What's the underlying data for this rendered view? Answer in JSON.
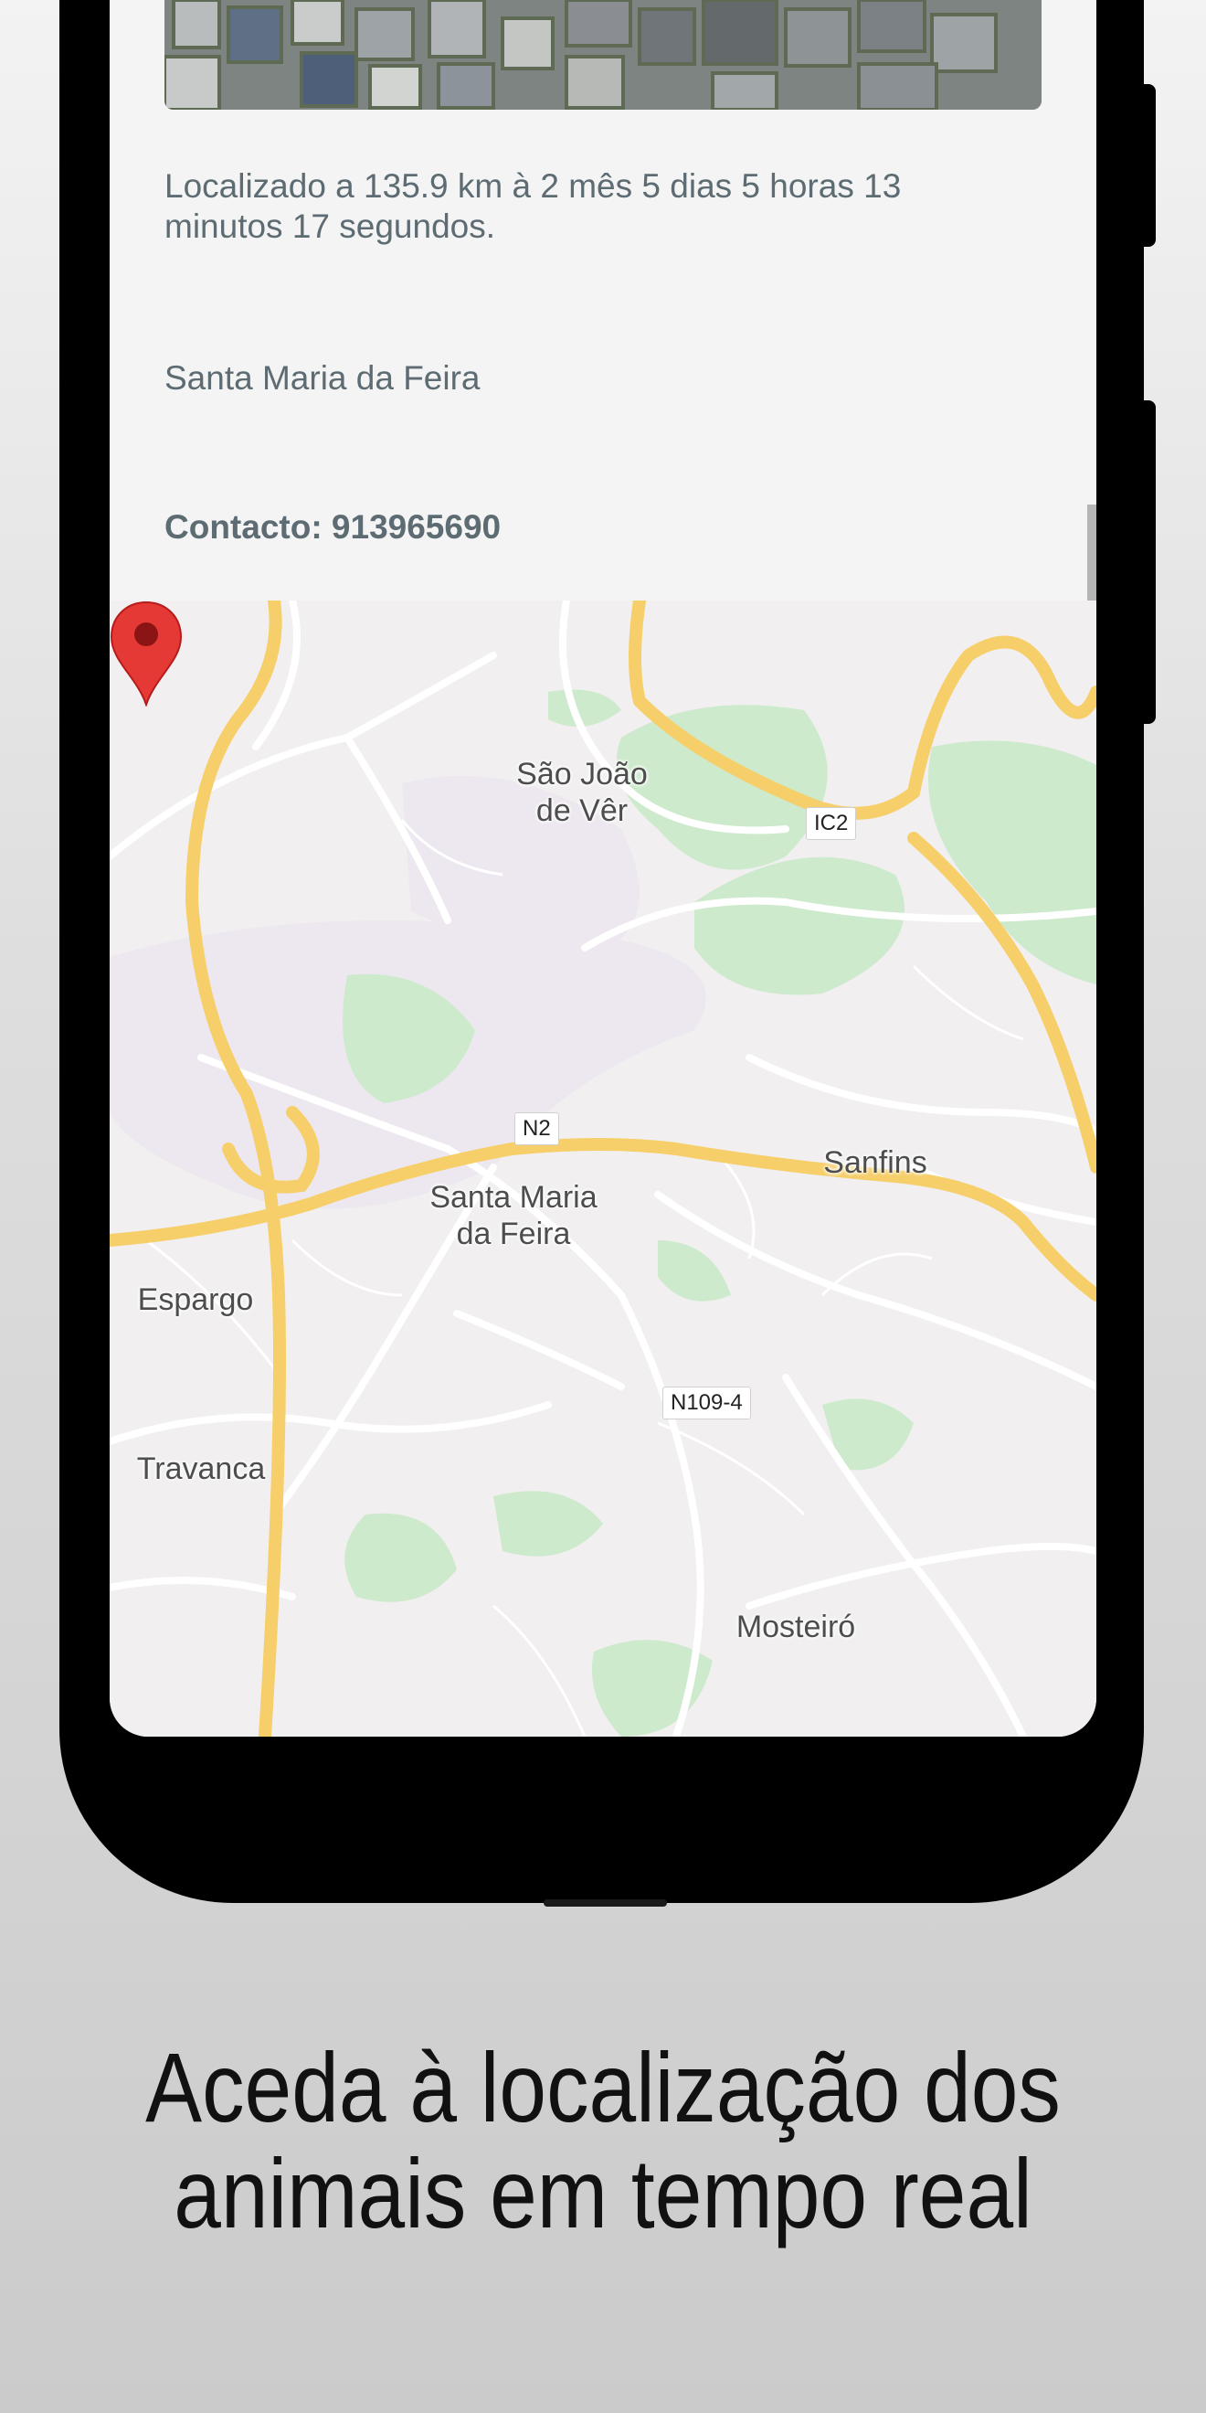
{
  "card": {
    "distance_text": "Localizado a 135.9 km à 2 mês 5 dias 5 horas 13 minutos 17 segundos.",
    "locality": "Santa Maria da Feira",
    "contact": "Contacto: 913965690"
  },
  "map": {
    "place_labels": {
      "sao_joao": "São João\nde Vêr",
      "santa_maria": "Santa Maria\nda Feira",
      "sanfins": "Sanfins",
      "espargo": "Espargo",
      "travanca": "Travanca",
      "mosteiro": "Mosteiró"
    },
    "road_badges": {
      "ic2": "IC2",
      "n2": "N2",
      "n109_4": "N109-4"
    },
    "pin_color": "#e53935"
  },
  "caption": "Aceda à localização dos animais em tempo real",
  "icons": [
    "map-pin-icon"
  ]
}
